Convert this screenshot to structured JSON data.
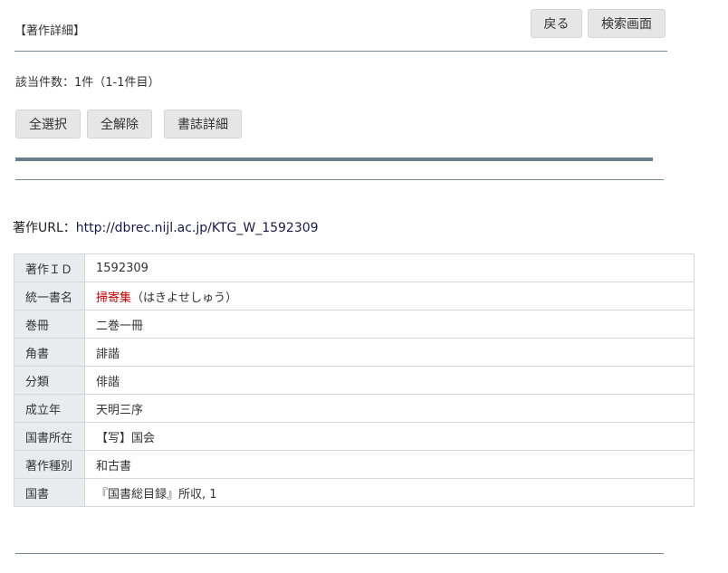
{
  "header": {
    "title": "【著作詳細】",
    "back_label": "戻る",
    "search_screen_label": "検索画面"
  },
  "result_count": "該当件数：1件（1-1件目）",
  "toolbar": {
    "select_all_label": "全選択",
    "deselect_all_label": "全解除",
    "bib_detail_label": "書誌詳細"
  },
  "url": {
    "label": "著作URL：",
    "value": "http://dbrec.nijl.ac.jp/KTG_W_1592309"
  },
  "details": {
    "work_id": {
      "label": "著作ＩＤ",
      "value": "1592309"
    },
    "unified_title": {
      "label": "統一書名",
      "title": "掃寄集",
      "reading": "（はきよせしゅう）"
    },
    "volumes": {
      "label": "巻冊",
      "value": "二巻一冊"
    },
    "kakugaki": {
      "label": "角書",
      "value": "誹諧"
    },
    "category": {
      "label": "分類",
      "value": "俳諧"
    },
    "established": {
      "label": "成立年",
      "value": "天明三序"
    },
    "holdings": {
      "label": "国書所在",
      "value": "【写】国会"
    },
    "work_type": {
      "label": "著作種別",
      "value": "和古書"
    },
    "kokusho": {
      "label": "国書",
      "value": "『国書総目録』所収, 1"
    }
  },
  "colors": {
    "accent_bar": "#6b7d8c",
    "label_bg": "#e8ecef",
    "title_red": "#cc0000"
  }
}
